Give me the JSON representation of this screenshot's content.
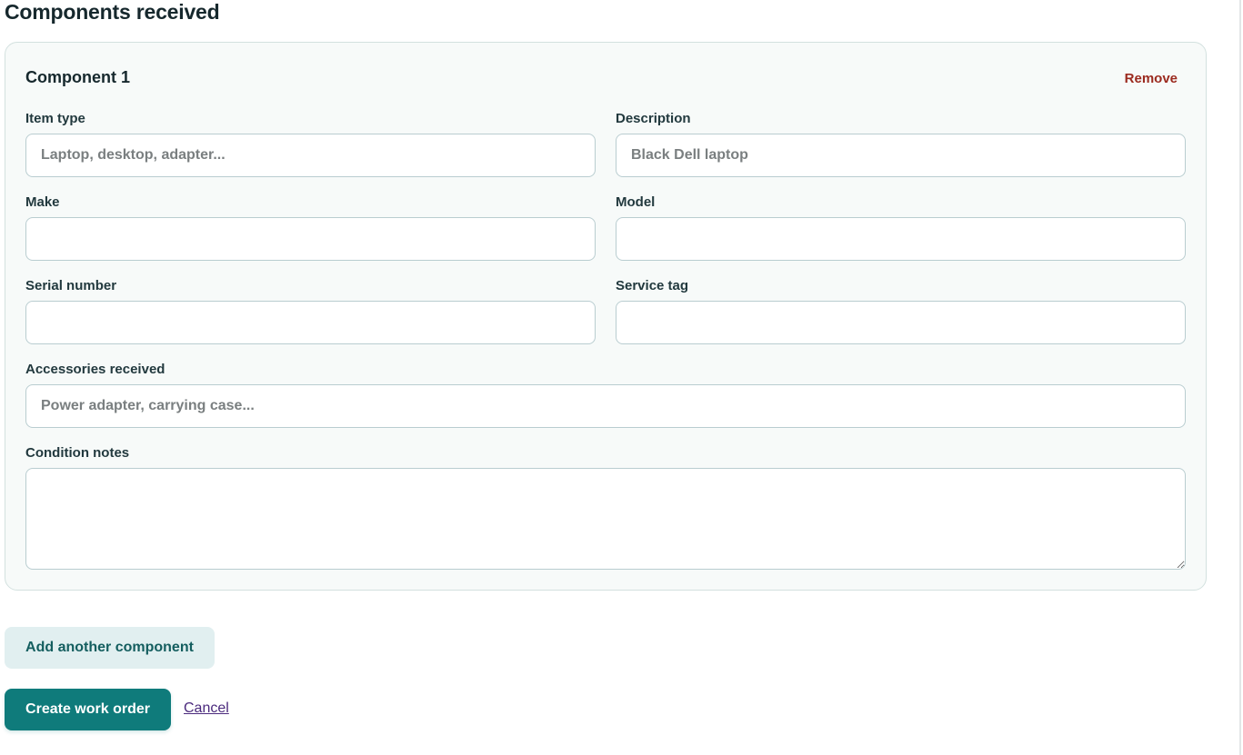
{
  "section": {
    "title": "Components received"
  },
  "component": {
    "title": "Component 1",
    "remove_label": "Remove",
    "fields": {
      "item_type": {
        "label": "Item type",
        "value": "",
        "placeholder": "Laptop, desktop, adapter..."
      },
      "description": {
        "label": "Description",
        "value": "",
        "placeholder": "Black Dell laptop"
      },
      "make": {
        "label": "Make",
        "value": "",
        "placeholder": ""
      },
      "model": {
        "label": "Model",
        "value": "",
        "placeholder": ""
      },
      "serial_number": {
        "label": "Serial number",
        "value": "",
        "placeholder": ""
      },
      "service_tag": {
        "label": "Service tag",
        "value": "",
        "placeholder": ""
      },
      "accessories": {
        "label": "Accessories received",
        "value": "",
        "placeholder": "Power adapter, carrying case..."
      },
      "condition_notes": {
        "label": "Condition notes",
        "value": "",
        "placeholder": ""
      }
    }
  },
  "actions": {
    "add_component_label": "Add another component",
    "create_label": "Create work order",
    "cancel_label": "Cancel"
  },
  "colors": {
    "remove": "#9b2a1f",
    "primary": "#0f7b7b",
    "secondary_bg": "#e1eff0",
    "link": "#4b2a7d"
  }
}
